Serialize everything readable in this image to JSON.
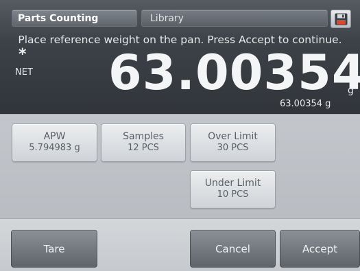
{
  "header": {
    "app_tab": "Parts Counting",
    "library_tab": "Library",
    "save_icon": "floppy-disk-icon"
  },
  "display": {
    "instruction": "Place reference weight on the pan.  Press Accept to continue.",
    "stability_indicator": "*",
    "net_label": "NET",
    "main_weight": "63.00354",
    "main_unit": "g",
    "secondary_weight": "63.00354 g"
  },
  "data_fields": {
    "apw": {
      "label": "APW",
      "value": "5.794983 g"
    },
    "samples": {
      "label": "Samples",
      "value": "12 PCS"
    },
    "over_limit": {
      "label": "Over Limit",
      "value": "30 PCS"
    },
    "under_limit": {
      "label": "Under Limit",
      "value": "10 PCS"
    }
  },
  "actions": {
    "tare": "Tare",
    "cancel": "Cancel",
    "accept": "Accept"
  },
  "colors": {
    "display_background": "#3d4248",
    "panel_background": "#c3c7cc",
    "action_button": "#6f757b"
  }
}
